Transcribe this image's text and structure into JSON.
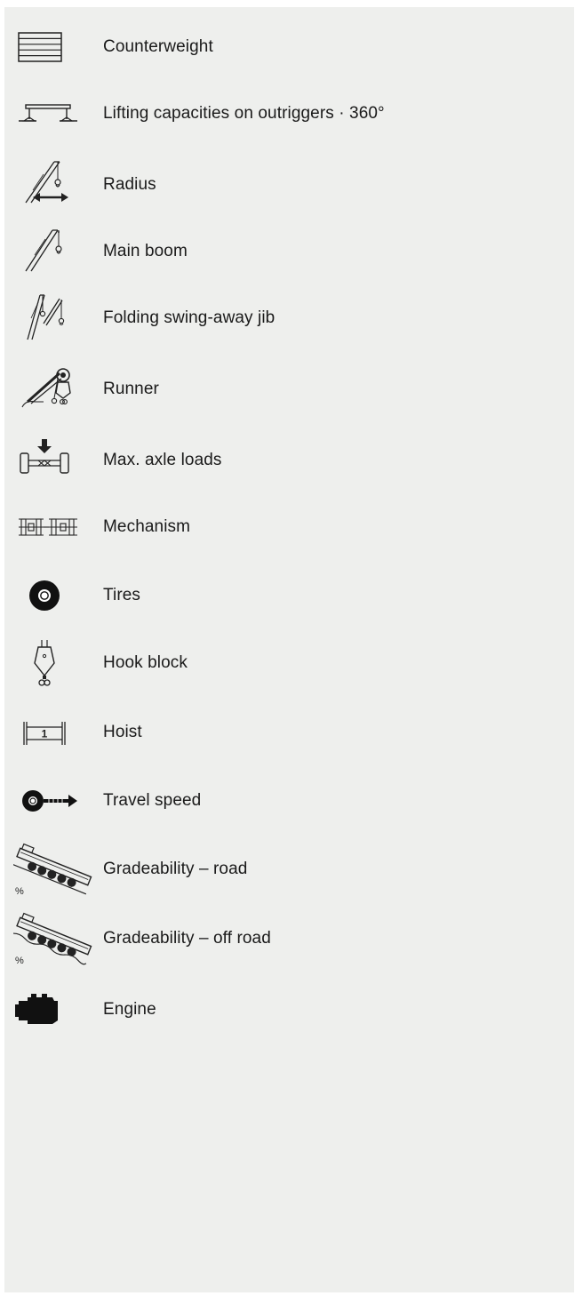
{
  "legend": {
    "items": [
      {
        "label": "Counterweight",
        "icon": "counterweight-icon"
      },
      {
        "label": "Lifting capacities on outriggers · 360°",
        "icon": "outriggers-icon"
      },
      {
        "label": "Radius",
        "icon": "radius-icon"
      },
      {
        "label": "Main boom",
        "icon": "main-boom-icon"
      },
      {
        "label": "Folding swing-away jib",
        "icon": "swing-away-jib-icon"
      },
      {
        "label": "Runner",
        "icon": "runner-icon"
      },
      {
        "label": "Max. axle loads",
        "icon": "axle-load-icon"
      },
      {
        "label": "Mechanism",
        "icon": "mechanism-icon"
      },
      {
        "label": "Tires",
        "icon": "tire-icon"
      },
      {
        "label": "Hook block",
        "icon": "hook-block-icon"
      },
      {
        "label": "Hoist",
        "icon": "hoist-icon",
        "icon_text": "1"
      },
      {
        "label": "Travel speed",
        "icon": "travel-speed-icon"
      },
      {
        "label": "Gradeability – road",
        "icon": "gradeability-road-icon",
        "icon_text": "%"
      },
      {
        "label": "Gradeability – off road",
        "icon": "gradeability-offroad-icon",
        "icon_text": "%"
      },
      {
        "label": "Engine",
        "icon": "engine-icon"
      }
    ]
  },
  "colors": {
    "panel_background": "#eeefed",
    "text": "#1a1a1a",
    "icon": "#222222"
  }
}
